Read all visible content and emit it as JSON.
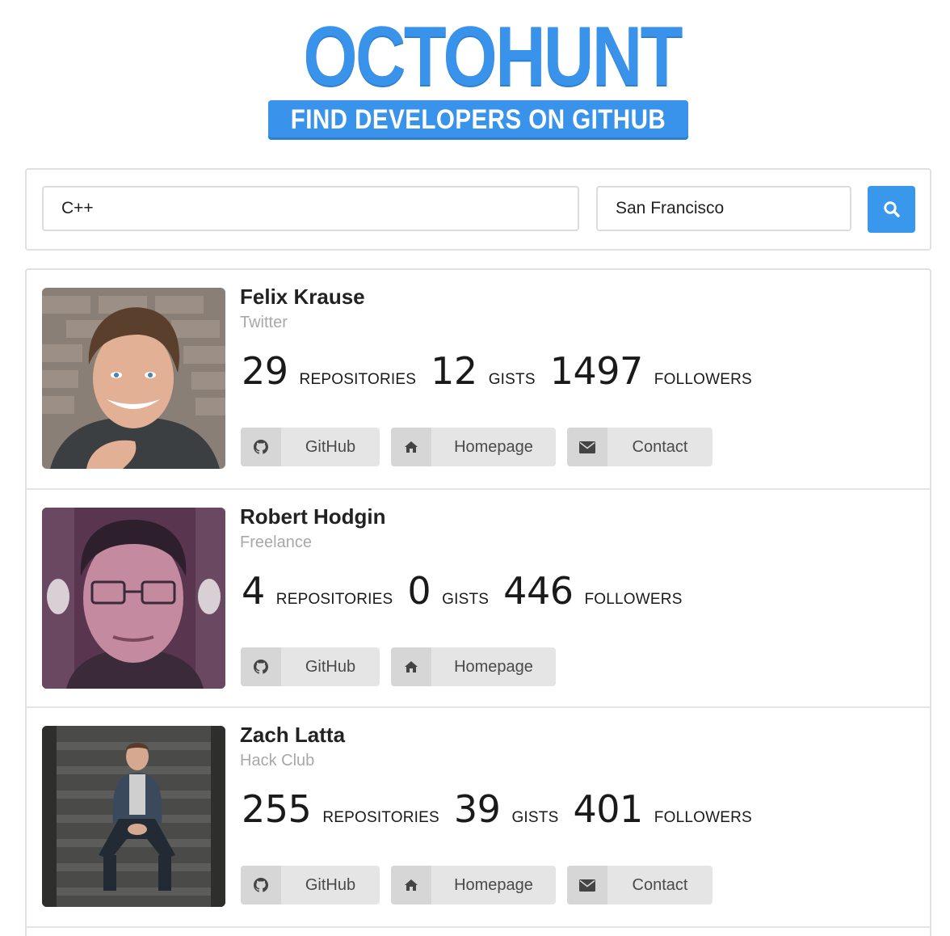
{
  "logo": {
    "title": "OCTOHUNT",
    "tagline": "FIND DEVELOPERS ON GITHUB"
  },
  "search": {
    "language": "C++",
    "location": "San Francisco",
    "button_icon": "search-icon"
  },
  "colors": {
    "brand_blue": "#3a93ea",
    "button_gray": "#e5e5e5",
    "icon_gray": "#d6d6d6",
    "muted_text": "#a8a8a8"
  },
  "developers": [
    {
      "name": "Felix Krause",
      "company": "Twitter",
      "repositories": "29",
      "gists": "12",
      "followers": "1497",
      "labels": {
        "repositories": "REPOSITORIES",
        "gists": "GISTS",
        "followers": "FOLLOWERS"
      },
      "buttons": {
        "github": "GitHub",
        "homepage": "Homepage",
        "contact": "Contact"
      }
    },
    {
      "name": "Robert Hodgin",
      "company": "Freelance",
      "repositories": "4",
      "gists": "0",
      "followers": "446",
      "labels": {
        "repositories": "REPOSITORIES",
        "gists": "GISTS",
        "followers": "FOLLOWERS"
      },
      "buttons": {
        "github": "GitHub",
        "homepage": "Homepage"
      }
    },
    {
      "name": "Zach Latta",
      "company": "Hack Club",
      "repositories": "255",
      "gists": "39",
      "followers": "401",
      "labels": {
        "repositories": "REPOSITORIES",
        "gists": "GISTS",
        "followers": "FOLLOWERS"
      },
      "buttons": {
        "github": "GitHub",
        "homepage": "Homepage",
        "contact": "Contact"
      }
    }
  ]
}
